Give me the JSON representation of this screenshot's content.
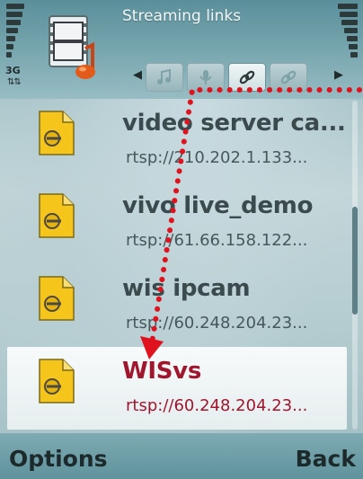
{
  "header": {
    "title": "Streaming links",
    "network_label": "3G",
    "tabs": [
      "music-tab",
      "mic-tab",
      "link-tab",
      "link-alt-tab"
    ]
  },
  "items": [
    {
      "name": "video server ca...",
      "url": "rtsp://210.202.1.133..."
    },
    {
      "name": "vivo live_demo",
      "url": "rtsp://61.66.158.122..."
    },
    {
      "name": "wis ipcam",
      "url": "rtsp://60.248.204.23..."
    },
    {
      "name": "WISvs",
      "url": "rtsp://60.248.204.23..."
    }
  ],
  "selected_index": 3,
  "softkeys": {
    "left": "Options",
    "right": "Back"
  },
  "colors": {
    "accent_selected": "#a0162e",
    "annotation": "#e0121e",
    "background": "#b3cbcf"
  }
}
